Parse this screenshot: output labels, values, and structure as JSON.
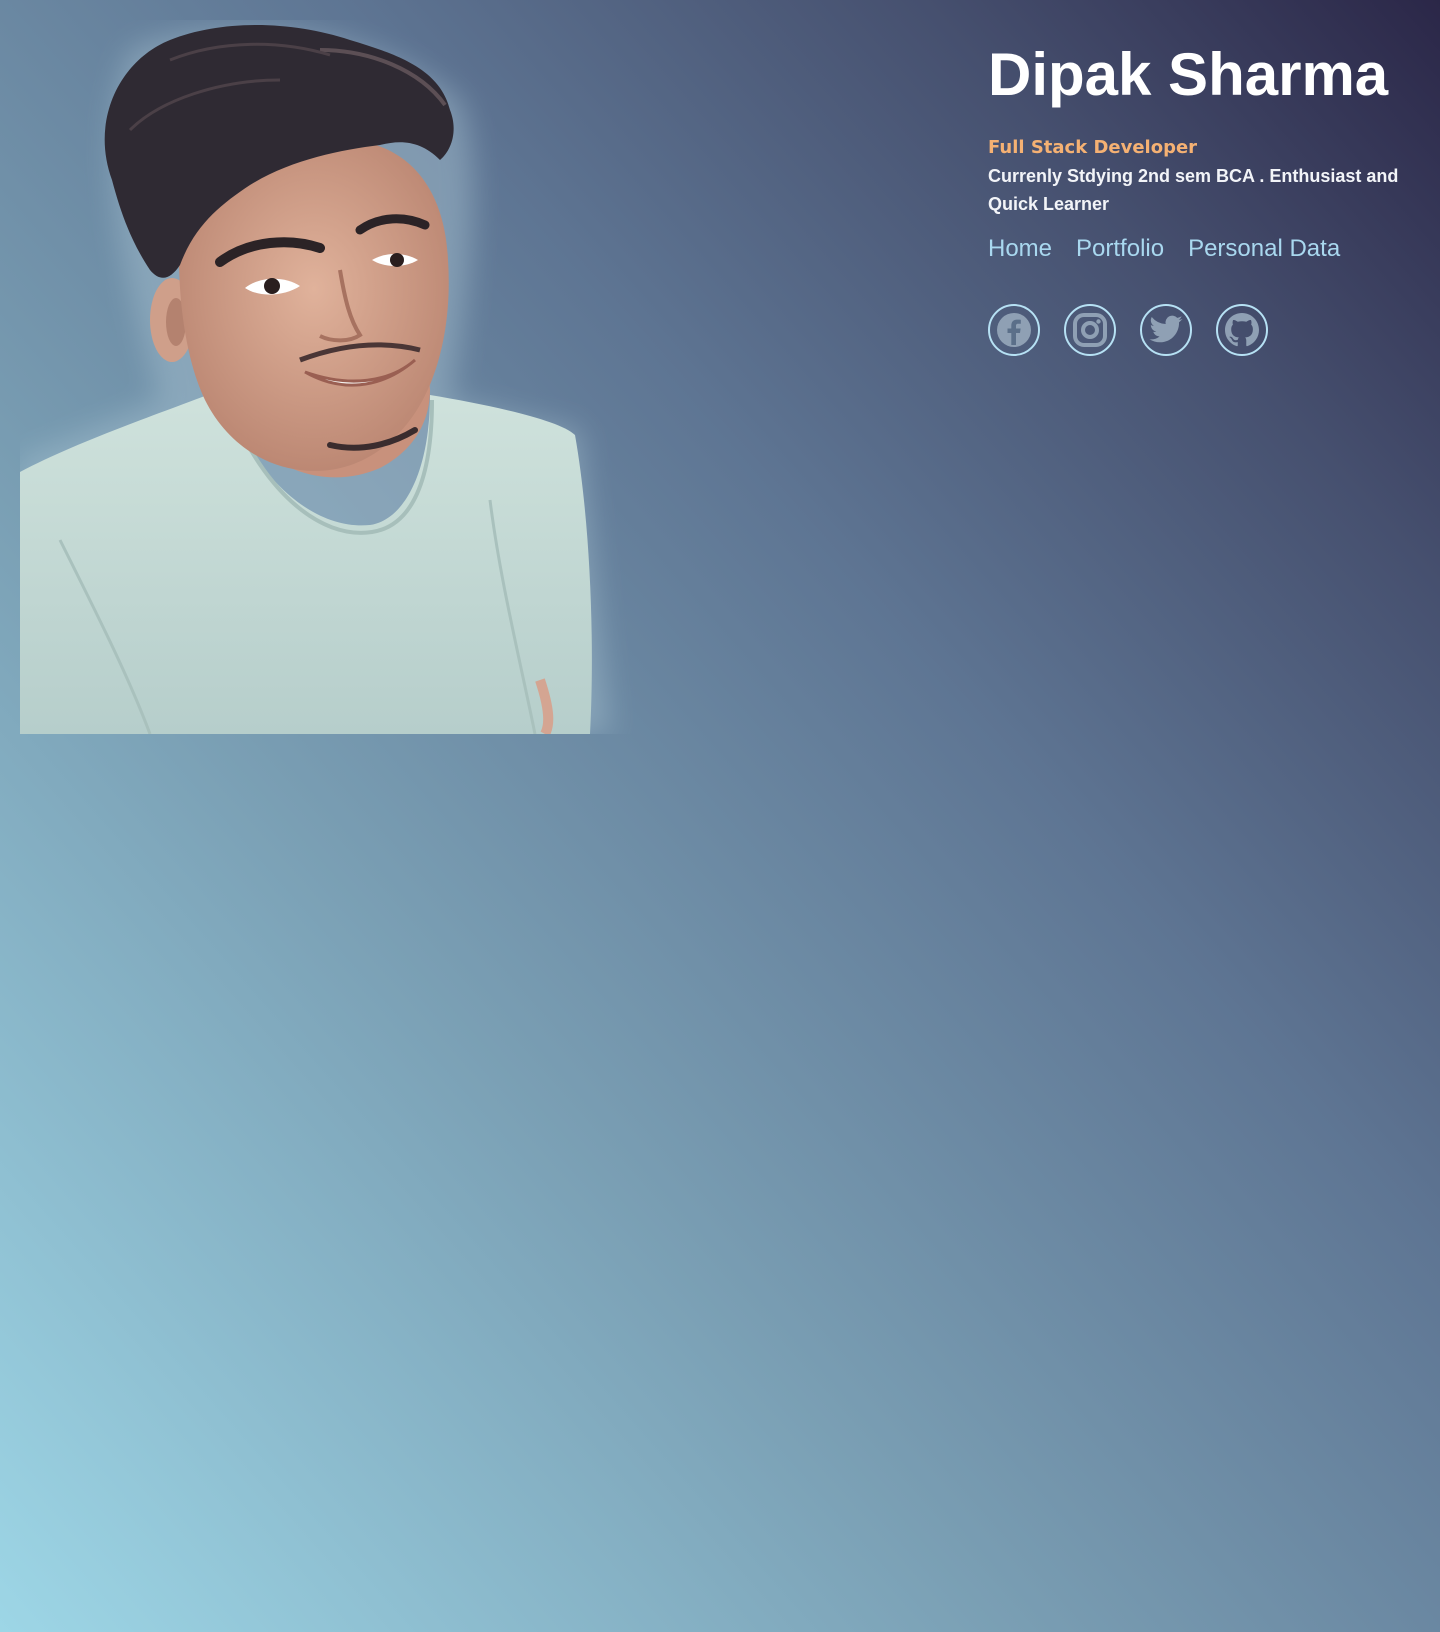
{
  "profile": {
    "name": "Dipak Sharma",
    "role": "Full Stack Developer",
    "bio": "Currenly Stdying 2nd sem BCA . Enthusiast and Quick Learner"
  },
  "nav": {
    "items": [
      {
        "label": "Home"
      },
      {
        "label": "Portfolio"
      },
      {
        "label": "Personal Data"
      }
    ]
  },
  "social": [
    {
      "icon": "facebook-icon"
    },
    {
      "icon": "instagram-icon"
    },
    {
      "icon": "twitter-icon"
    },
    {
      "icon": "github-icon"
    }
  ],
  "colors": {
    "name": "#ffffff",
    "role": "#f5b173",
    "bio": "#f2f4f8",
    "nav_link": "#a9d8ef",
    "social_ring": "#b6e1f4",
    "social_glyph": "#8fa0b4",
    "background_top_right": "#2b2748",
    "background_bottom_left": "#9dd6e6"
  }
}
